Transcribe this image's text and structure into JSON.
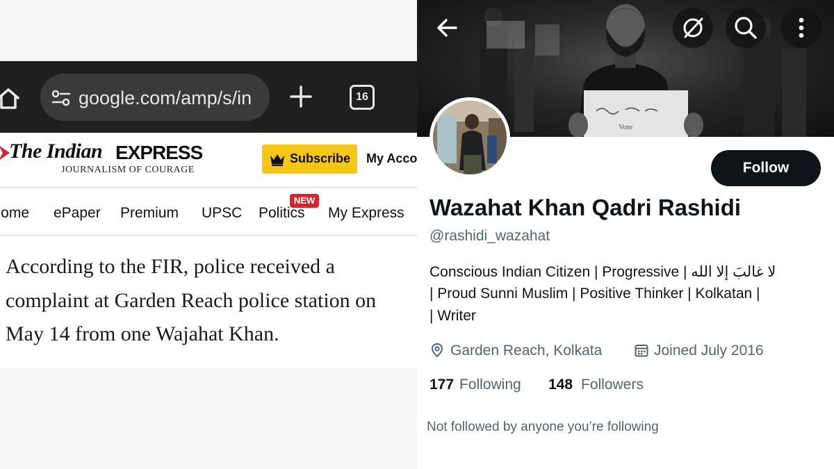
{
  "left": {
    "browser": {
      "url": "google.com/amp/s/in",
      "tab_count": "16",
      "home_icon": "home-icon",
      "site_settings_icon": "tune-icon",
      "new_tab_icon": "plus-icon"
    },
    "site": {
      "logo_italic": "The Indian",
      "logo_bold": "EXPRESS",
      "tagline": "JOURNALISM OF COURAGE",
      "subscribe_label": "Subscribe",
      "account_label": "My Acco",
      "brand_red": "#d8232a",
      "subscribe_color": "#f5c518"
    },
    "nav": {
      "items": [
        "Home",
        "ePaper",
        "Premium",
        "UPSC",
        "Politics",
        "My Express"
      ],
      "politics_badge": "NEW"
    },
    "article": {
      "text": "According to the FIR, police received a complaint at Garden Reach police station on May 14 from one Wajahat Khan."
    }
  },
  "right": {
    "header": {
      "back_icon": "arrow-left-icon",
      "grok_icon": "grok-icon",
      "search_icon": "search-icon",
      "more_icon": "more-vertical-icon",
      "banner_sign_text": "Vote"
    },
    "profile": {
      "follow_label": "Follow",
      "display_name": "Wazahat Khan Qadri Rashidi",
      "handle": "@rashidi_wazahat",
      "bio_lines": [
        "Conscious Indian Citizen | Progressive | لا غالبَ إلا الله",
        "| Proud Sunni Muslim | Positive Thinker | Kolkatan |",
        "| Writer"
      ],
      "location": "Garden Reach, Kolkata",
      "joined": "Joined July 2016",
      "following_count": "177",
      "following_label": "Following",
      "followers_count": "148",
      "followers_label": "Followers",
      "not_followed_text": "Not followed by anyone you’re following",
      "text_color": "#0f1419",
      "secondary_color": "#536471"
    }
  }
}
